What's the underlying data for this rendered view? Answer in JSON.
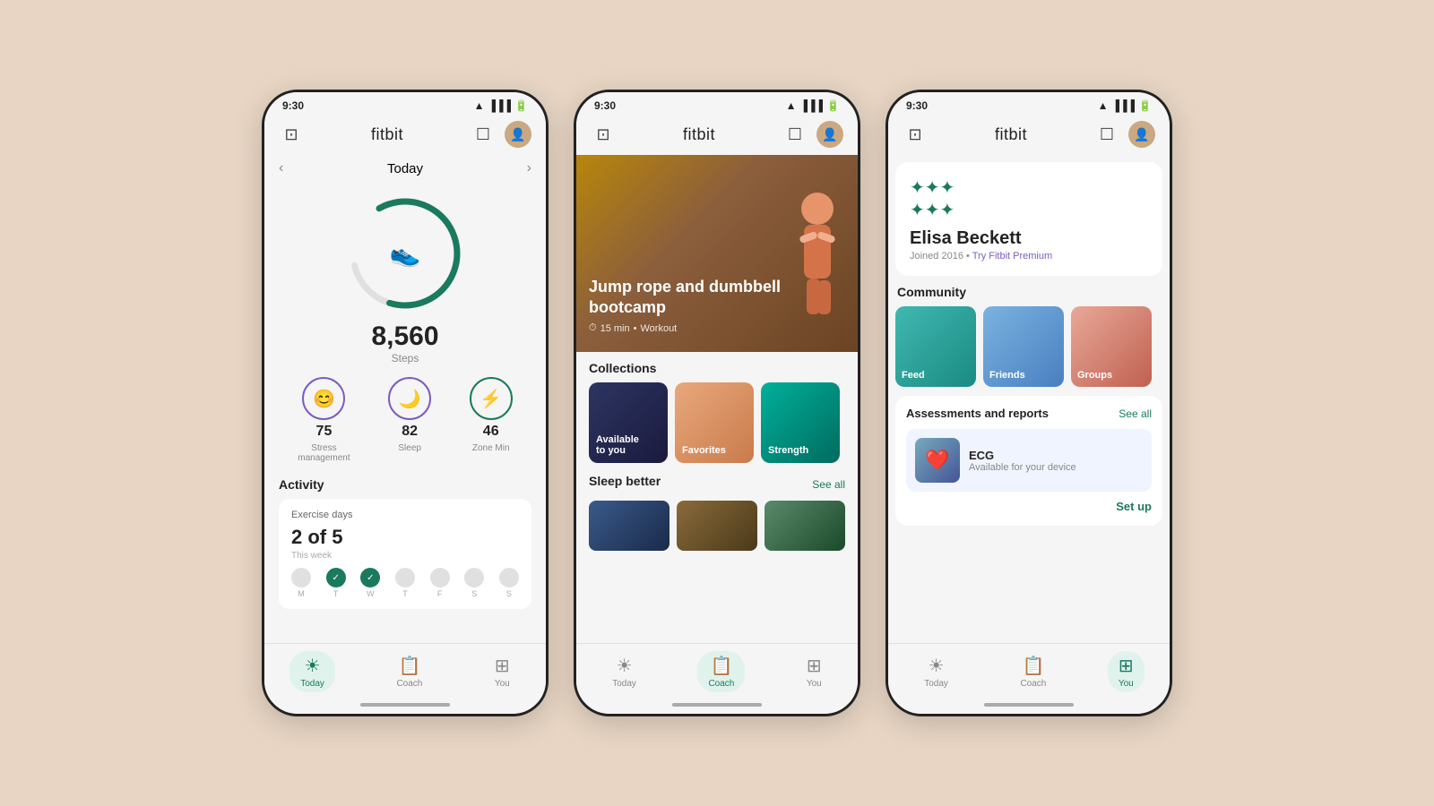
{
  "background": "#e8d5c4",
  "phone1": {
    "statusTime": "9:30",
    "title": "fitbit",
    "navDate": "Today",
    "steps": "8,560",
    "stepsLabel": "Steps",
    "metrics": [
      {
        "icon": "😊",
        "value": "75",
        "label": "Stress\nmanagement",
        "type": "purple"
      },
      {
        "icon": "🌙",
        "value": "82",
        "label": "Sleep",
        "type": "purple"
      },
      {
        "icon": "⚡",
        "value": "46",
        "label": "Zone Min",
        "type": "teal"
      }
    ],
    "activityTitle": "Activity",
    "exerciseDays": "Exercise days",
    "exerciseCount": "2 of 5",
    "exerciseSub": "This week",
    "days": [
      "M",
      "T",
      "W",
      "T",
      "F",
      "S",
      "S"
    ],
    "daysStatus": [
      false,
      true,
      true,
      false,
      false,
      false,
      false
    ],
    "nav": [
      {
        "icon": "☀️",
        "label": "Today",
        "active": true
      },
      {
        "icon": "📋",
        "label": "Coach",
        "active": false
      },
      {
        "icon": "⊞",
        "label": "You",
        "active": false
      }
    ]
  },
  "phone2": {
    "statusTime": "9:30",
    "title": "fitbit",
    "heroTitle": "Jump rope and dumbbell bootcamp",
    "heroDuration": "15 min",
    "heroType": "Workout",
    "collectionsTitle": "Collections",
    "collections": [
      {
        "label": "Available\nto you",
        "type": "available"
      },
      {
        "label": "Favorites",
        "type": "favorites"
      },
      {
        "label": "Strength",
        "type": "strength"
      }
    ],
    "sleepTitle": "Sleep better",
    "seeAll": "See all",
    "nav": [
      {
        "icon": "☀️",
        "label": "Today",
        "active": false
      },
      {
        "icon": "📋",
        "label": "Coach",
        "active": true
      },
      {
        "icon": "⊞",
        "label": "You",
        "active": false
      }
    ]
  },
  "phone3": {
    "statusTime": "9:30",
    "title": "fitbit",
    "profileName": "Elisa Beckett",
    "profileMeta": "Joined 2016 • Try Fitbit Premium",
    "communityTitle": "Community",
    "community": [
      {
        "label": "Feed",
        "type": "feed"
      },
      {
        "label": "Friends",
        "type": "friends"
      },
      {
        "label": "Groups",
        "type": "groups"
      }
    ],
    "assessmentsTitle": "Assessments and reports",
    "seeAll": "See all",
    "ecgTitle": "ECG",
    "ecgDesc": "Available for your device",
    "setupBtn": "Set up",
    "nav": [
      {
        "icon": "☀️",
        "label": "Today",
        "active": false
      },
      {
        "icon": "📋",
        "label": "Coach",
        "active": false
      },
      {
        "icon": "⊞",
        "label": "You",
        "active": true
      }
    ]
  }
}
